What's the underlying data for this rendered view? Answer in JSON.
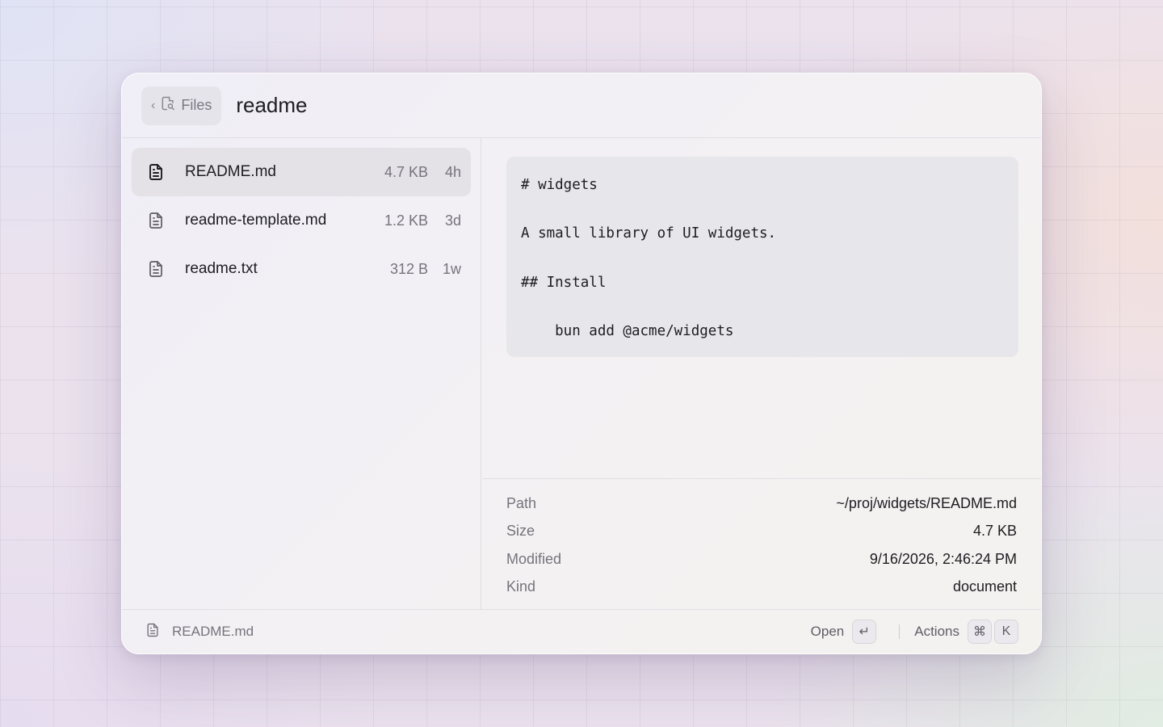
{
  "header": {
    "back_label": "Files",
    "query": "readme"
  },
  "results": [
    {
      "name": "README.md",
      "size": "4.7 KB",
      "age": "4h",
      "selected": true
    },
    {
      "name": "readme-template.md",
      "size": "1.2 KB",
      "age": "3d",
      "selected": false
    },
    {
      "name": "readme.txt",
      "size": "312 B",
      "age": "1w",
      "selected": false
    }
  ],
  "preview": {
    "content": "# widgets\n\nA small library of UI widgets.\n\n## Install\n\n    bun add @acme/widgets"
  },
  "metadata": [
    {
      "key": "Path",
      "value": "~/proj/widgets/README.md"
    },
    {
      "key": "Size",
      "value": "4.7 KB"
    },
    {
      "key": "Modified",
      "value": "9/16/2026, 2:46:24 PM"
    },
    {
      "key": "Kind",
      "value": "document"
    }
  ],
  "footer": {
    "selected_file": "README.md",
    "open_label": "Open",
    "open_key": "↵",
    "actions_label": "Actions",
    "actions_keys": [
      "⌘",
      "K"
    ]
  },
  "icons": {
    "file": "file-text-icon",
    "files_search": "file-search-icon",
    "back": "chevron-left-icon"
  }
}
